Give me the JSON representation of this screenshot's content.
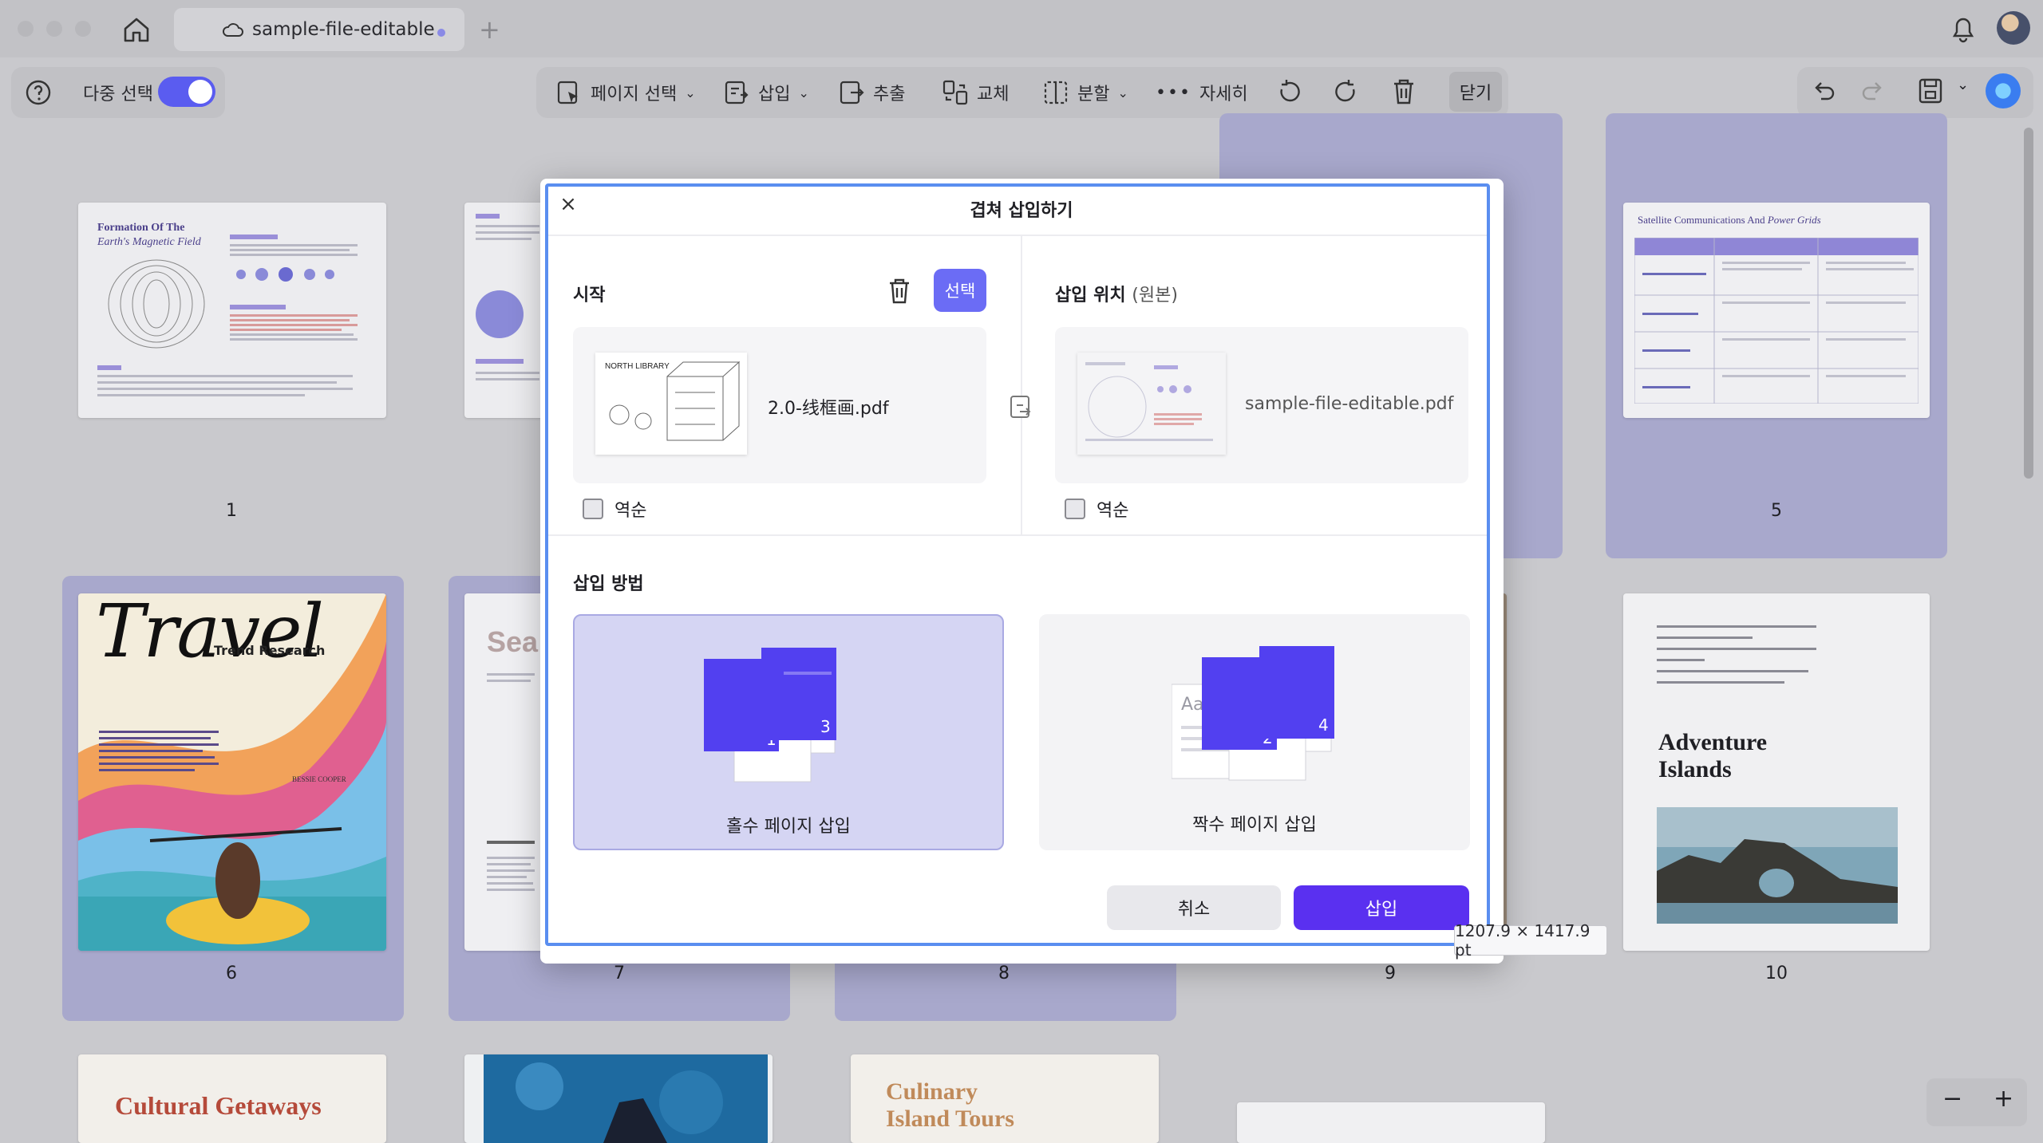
{
  "window": {
    "tab_title": "sample-file-editable",
    "new_tab": "+"
  },
  "toolbar": {
    "multi_select_label": "다중 선택",
    "multi_select_on": true,
    "page_select": "페이지 선택",
    "insert": "삽입",
    "extract": "추출",
    "replace": "교체",
    "split": "분할",
    "more": "자세히",
    "close": "닫기"
  },
  "pages": [
    {
      "number": "1",
      "title_line1": "Formation Of The",
      "title_line2": "Earth's Magnetic Field"
    },
    {
      "number": "5",
      "title": "Satellite Communications And",
      "title_italic": "Power Grids"
    },
    {
      "number": "6",
      "heading": "Travel",
      "subheading": "Trend Research",
      "author": "BESSIE COOPER"
    },
    {
      "number": "7",
      "title_fragment": "Sea"
    },
    {
      "number": "8"
    },
    {
      "number": "9"
    },
    {
      "number": "10",
      "title_line1": "Adventure",
      "title_line2": "Islands"
    },
    {
      "title": "Cultural Getaways"
    },
    {
      "title_line1": "Culinary",
      "title_line2": "Island Tours"
    }
  ],
  "dialog": {
    "title": "겹쳐 삽입하기",
    "start_label": "시작",
    "select_button": "선택",
    "start_file": "2.0-线框画.pdf",
    "position_label": "삽입 위치",
    "position_sub": "(원본)",
    "target_file": "sample-file-editable.pdf",
    "reverse_label": "역순",
    "method_label": "삽입 방법",
    "odd_option": "홀수 페이지 삽입",
    "even_option": "짝수 페이지 삽입",
    "cancel": "취소",
    "insert": "삽입"
  },
  "size_tooltip": "1207.9 × 1417.9 pt",
  "colors": {
    "accent": "#5a30f0",
    "select": "#6b6cf5",
    "toggle": "#5a5cf0",
    "selected_card": "#a8a8cc"
  }
}
